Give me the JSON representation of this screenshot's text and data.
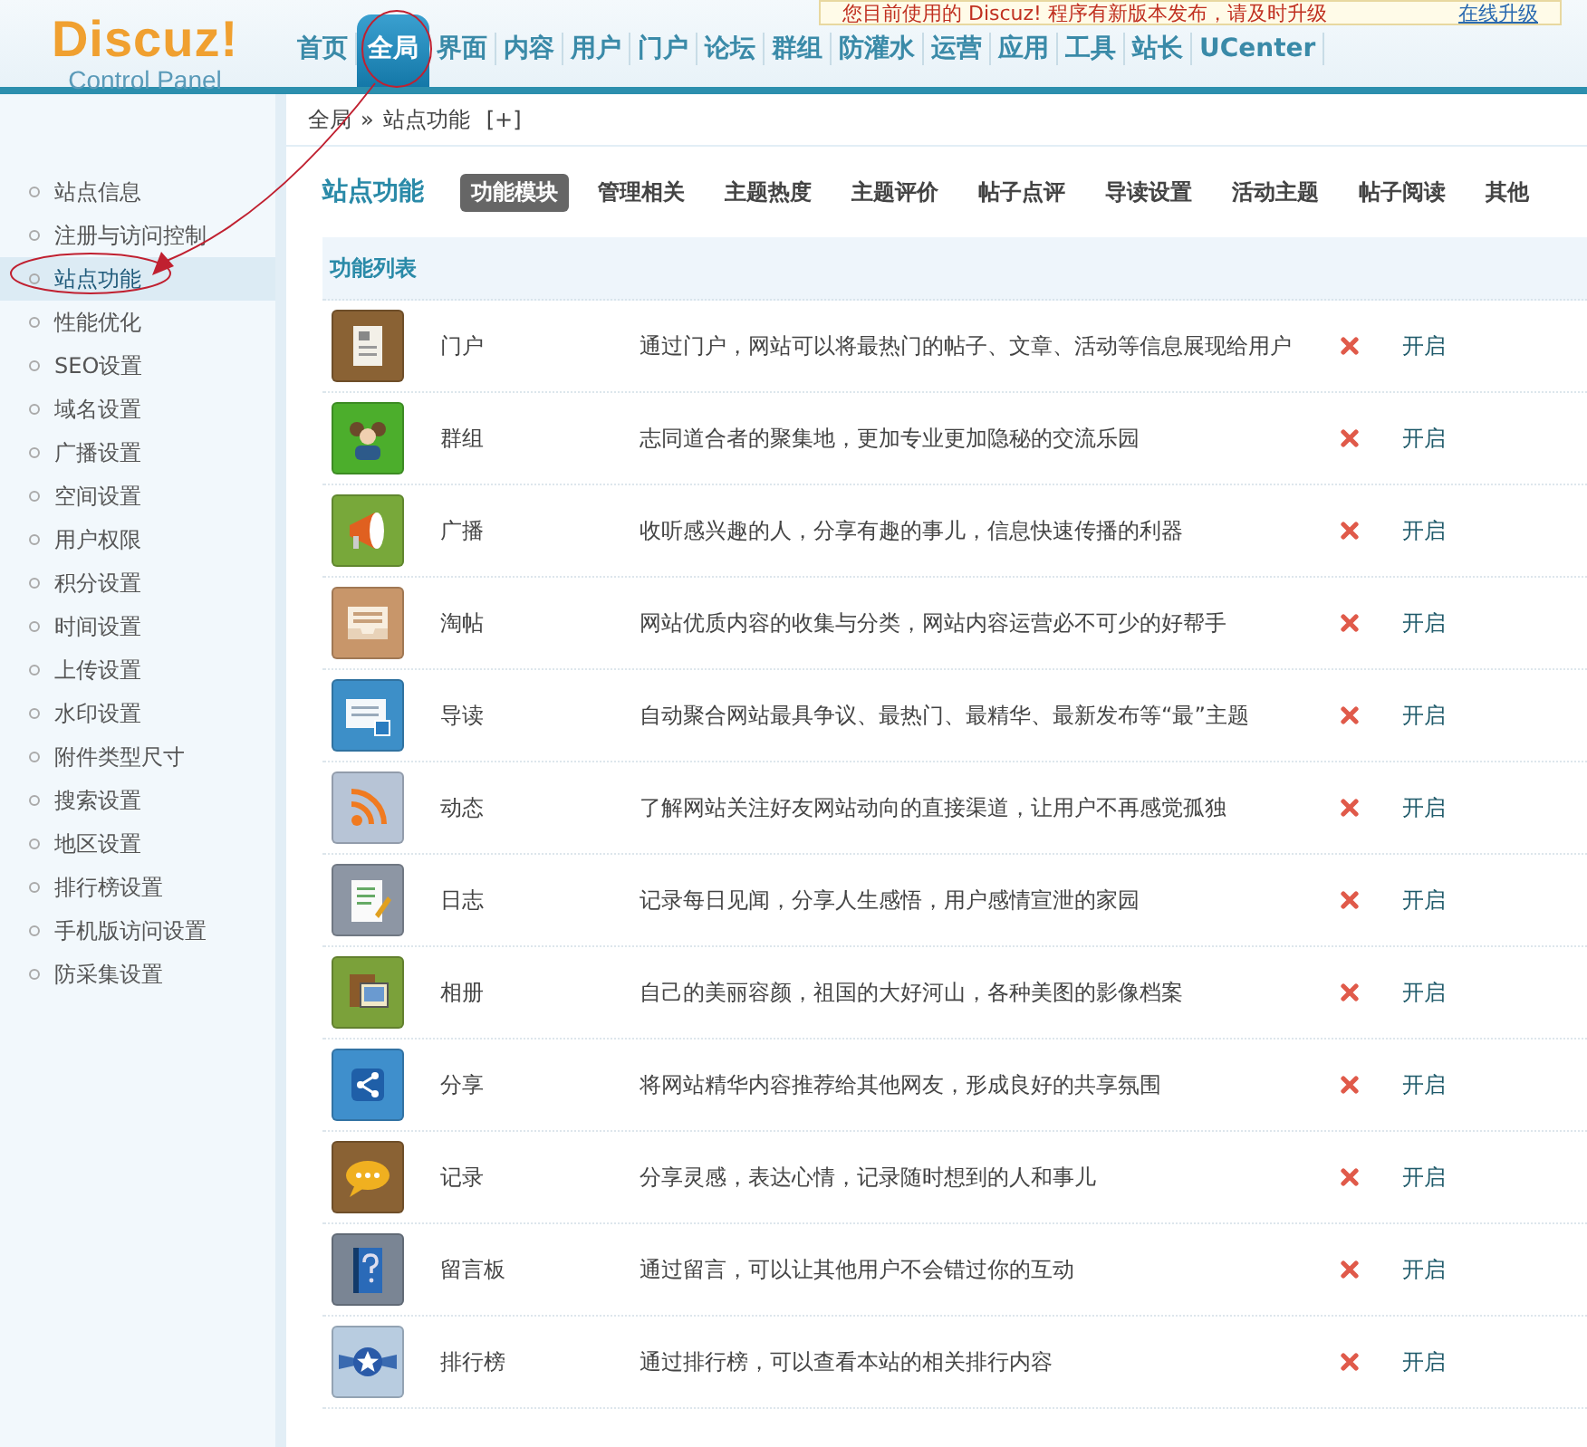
{
  "notice": {
    "text": "您目前使用的 Discuz! 程序有新版本发布，请及时升级",
    "link": "在线升级"
  },
  "logo": {
    "name": "Discuz!",
    "subtitle": "Control Panel"
  },
  "nav": [
    {
      "label": "首页",
      "selected": false
    },
    {
      "label": "全局",
      "selected": true
    },
    {
      "label": "界面",
      "selected": false
    },
    {
      "label": "内容",
      "selected": false
    },
    {
      "label": "用户",
      "selected": false
    },
    {
      "label": "门户",
      "selected": false
    },
    {
      "label": "论坛",
      "selected": false
    },
    {
      "label": "群组",
      "selected": false
    },
    {
      "label": "防灌水",
      "selected": false
    },
    {
      "label": "运营",
      "selected": false
    },
    {
      "label": "应用",
      "selected": false
    },
    {
      "label": "工具",
      "selected": false
    },
    {
      "label": "站长",
      "selected": false
    },
    {
      "label": "UCenter",
      "selected": false
    }
  ],
  "breadcrumb": {
    "parent": "全局",
    "separator": "»",
    "current": "站点功能",
    "add": "[+]"
  },
  "sidebar": {
    "items": [
      {
        "label": "站点信息",
        "selected": false
      },
      {
        "label": "注册与访问控制",
        "selected": false
      },
      {
        "label": "站点功能",
        "selected": true
      },
      {
        "label": "性能优化",
        "selected": false
      },
      {
        "label": "SEO设置",
        "selected": false
      },
      {
        "label": "域名设置",
        "selected": false
      },
      {
        "label": "广播设置",
        "selected": false
      },
      {
        "label": "空间设置",
        "selected": false
      },
      {
        "label": "用户权限",
        "selected": false
      },
      {
        "label": "积分设置",
        "selected": false
      },
      {
        "label": "时间设置",
        "selected": false
      },
      {
        "label": "上传设置",
        "selected": false
      },
      {
        "label": "水印设置",
        "selected": false
      },
      {
        "label": "附件类型尺寸",
        "selected": false
      },
      {
        "label": "搜索设置",
        "selected": false
      },
      {
        "label": "地区设置",
        "selected": false
      },
      {
        "label": "排行榜设置",
        "selected": false
      },
      {
        "label": "手机版访问设置",
        "selected": false
      },
      {
        "label": "防采集设置",
        "selected": false
      }
    ]
  },
  "page_title": "站点功能",
  "tabs": [
    {
      "label": "功能模块",
      "selected": true
    },
    {
      "label": "管理相关",
      "selected": false
    },
    {
      "label": "主题热度",
      "selected": false
    },
    {
      "label": "主题评价",
      "selected": false
    },
    {
      "label": "帖子点评",
      "selected": false
    },
    {
      "label": "导读设置",
      "selected": false
    },
    {
      "label": "活动主题",
      "selected": false
    },
    {
      "label": "帖子阅读",
      "selected": false
    },
    {
      "label": "其他",
      "selected": false
    }
  ],
  "table": {
    "title": "功能列表",
    "rows": [
      {
        "kind": "newspaper",
        "name": "门户",
        "description": "通过门户，网站可以将最热门的帖子、文章、活动等信息展现给用户",
        "enabled": false,
        "action": "开启"
      },
      {
        "kind": "people",
        "name": "群组",
        "description": "志同道合者的聚集地，更加专业更加隐秘的交流乐园",
        "enabled": false,
        "action": "开启"
      },
      {
        "kind": "megaphone",
        "name": "广播",
        "description": "收听感兴趣的人，分享有趣的事儿，信息快速传播的利器",
        "enabled": false,
        "action": "开启"
      },
      {
        "kind": "tray",
        "name": "淘帖",
        "description": "网站优质内容的收集与分类，网站内容运营必不可少的好帮手",
        "enabled": false,
        "action": "开启"
      },
      {
        "kind": "reader",
        "name": "导读",
        "description": "自动聚合网站最具争议、最热门、最精华、最新发布等“最”主题",
        "enabled": false,
        "action": "开启"
      },
      {
        "kind": "rss",
        "name": "动态",
        "description": "了解网站关注好友网站动向的直接渠道，让用户不再感觉孤独",
        "enabled": false,
        "action": "开启"
      },
      {
        "kind": "notepad",
        "name": "日志",
        "description": "记录每日见闻，分享人生感悟，用户感情宣泄的家园",
        "enabled": false,
        "action": "开启"
      },
      {
        "kind": "photos",
        "name": "相册",
        "description": "自己的美丽容颜，祖国的大好河山，各种美图的影像档案",
        "enabled": false,
        "action": "开启"
      },
      {
        "kind": "share",
        "name": "分享",
        "description": "将网站精华内容推荐给其他网友，形成良好的共享氛围",
        "enabled": false,
        "action": "开启"
      },
      {
        "kind": "speech",
        "name": "记录",
        "description": "分享灵感，表达心情，记录随时想到的人和事儿",
        "enabled": false,
        "action": "开启"
      },
      {
        "kind": "book",
        "name": "留言板",
        "description": "通过留言，可以让其他用户不会错过你的互动",
        "enabled": false,
        "action": "开启"
      },
      {
        "kind": "star",
        "name": "排行榜",
        "description": "通过排行榜，可以查看本站的相关排行内容",
        "enabled": false,
        "action": "开启"
      }
    ]
  }
}
